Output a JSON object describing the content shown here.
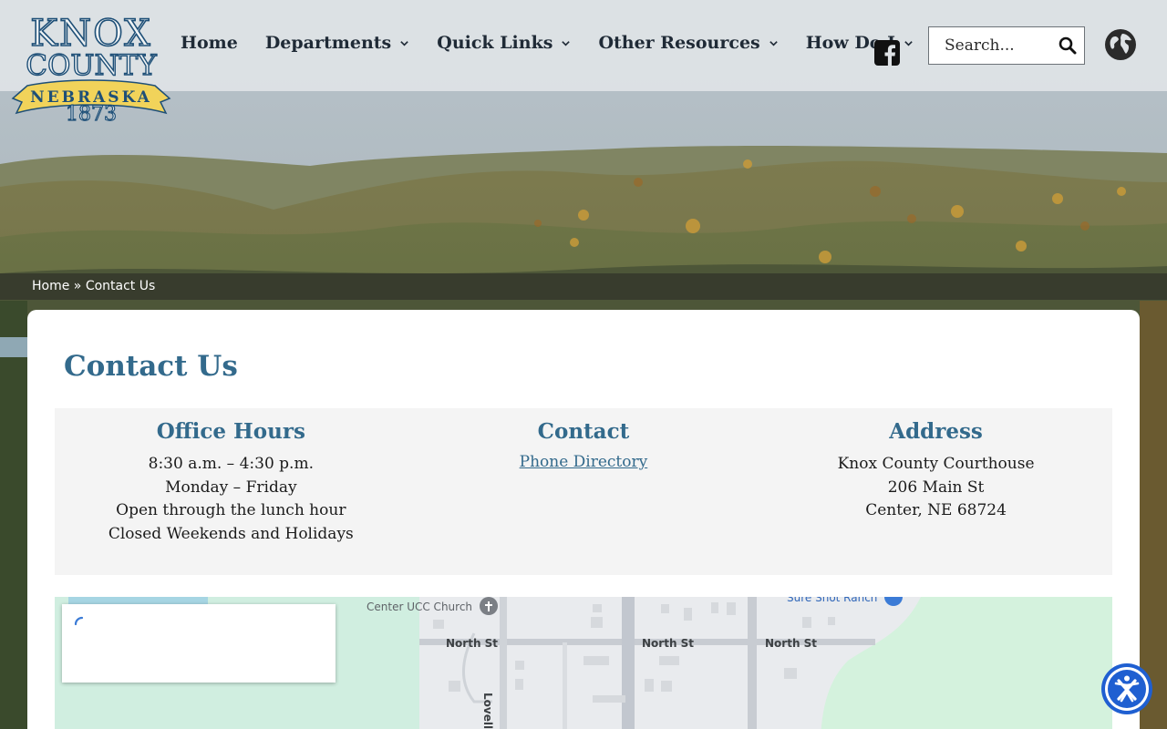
{
  "header": {
    "logo": {
      "line1": "KNOX",
      "line2": "COUNTY",
      "ribbon": "NEBRASKA",
      "year": "1873"
    },
    "nav": [
      {
        "label": "Home",
        "has_dropdown": false
      },
      {
        "label": "Departments",
        "has_dropdown": true
      },
      {
        "label": "Quick Links",
        "has_dropdown": true
      },
      {
        "label": "Other Resources",
        "has_dropdown": true
      },
      {
        "label": "How Do I",
        "has_dropdown": true
      }
    ],
    "social_icon": "facebook-icon",
    "search": {
      "placeholder": "Search..."
    },
    "language_icon": "globe-icon"
  },
  "breadcrumb": {
    "home": "Home",
    "separator": "»",
    "current": "Contact Us"
  },
  "page": {
    "title": "Contact Us",
    "office_hours": {
      "heading": "Office Hours",
      "lines": [
        "8:30 a.m. – 4:30 p.m.",
        "Monday – Friday",
        "Open through the lunch hour",
        "Closed Weekends and Holidays"
      ]
    },
    "contact": {
      "heading": "Contact",
      "link": "Phone Directory"
    },
    "address": {
      "heading": "Address",
      "lines": [
        "Knox County Courthouse",
        "206 Main St",
        "Center, NE 68724"
      ]
    }
  },
  "map": {
    "labels": {
      "church": "Center UCC Church",
      "ranch": "Sure Shot Ranch",
      "street1": "North St",
      "street2": "North St",
      "street3": "North St",
      "street4": "Lovell St"
    }
  },
  "colors": {
    "accent": "#336a8c",
    "header_bg": "#dee2e5",
    "logo_ribbon": "#f1d35a",
    "accessibility": "#1f5fd1"
  }
}
